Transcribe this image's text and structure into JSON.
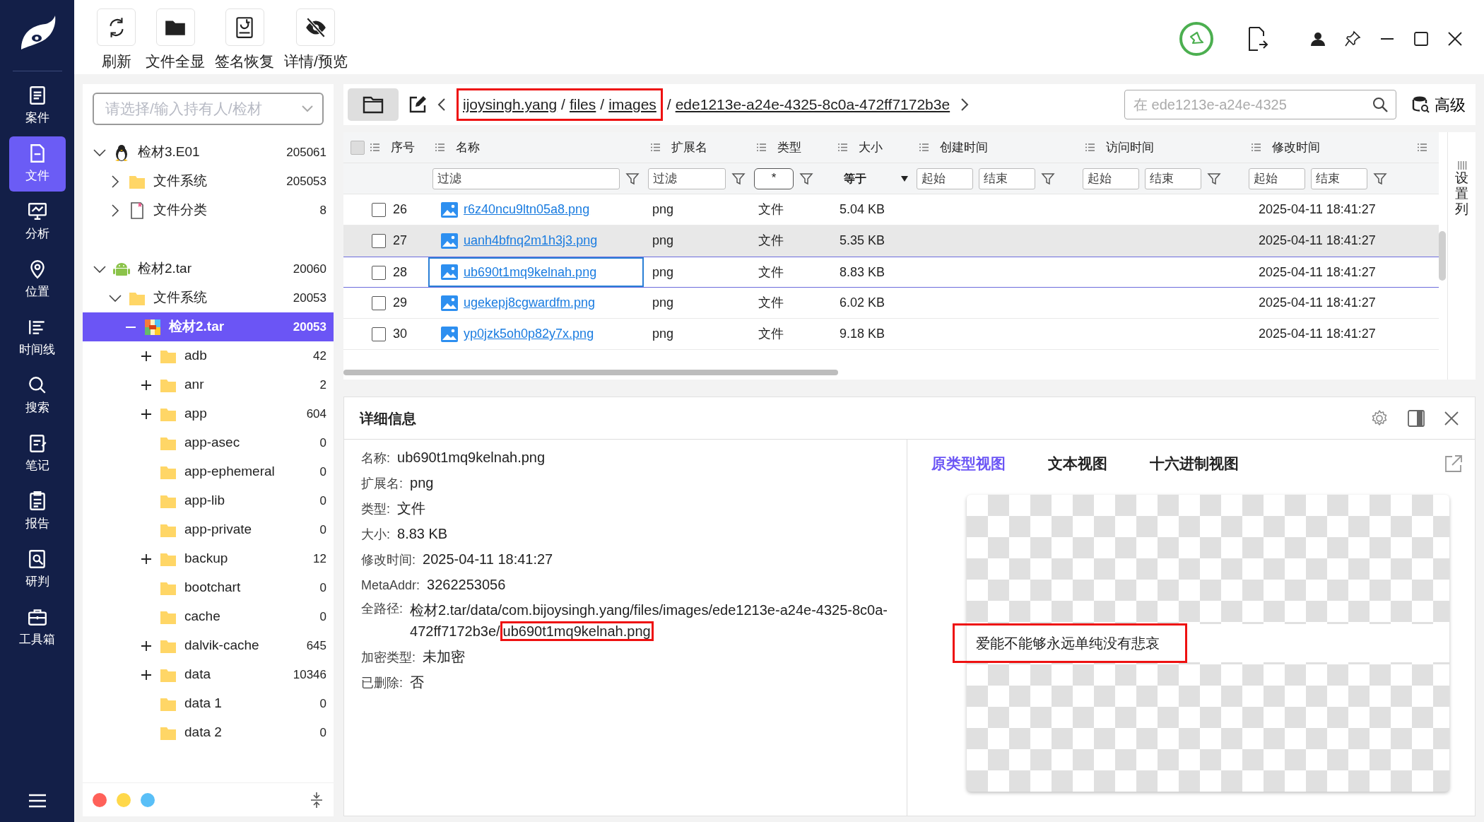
{
  "nav": {
    "items": [
      {
        "label": "案件",
        "selected": false
      },
      {
        "label": "文件",
        "selected": true
      },
      {
        "label": "分析",
        "selected": false
      },
      {
        "label": "位置",
        "selected": false
      },
      {
        "label": "时间线",
        "selected": false
      },
      {
        "label": "搜索",
        "selected": false
      },
      {
        "label": "笔记",
        "selected": false
      },
      {
        "label": "报告",
        "selected": false
      },
      {
        "label": "研判",
        "selected": false
      },
      {
        "label": "工具箱",
        "selected": false
      }
    ]
  },
  "toolbar": [
    "刷新",
    "文件全显",
    "签名恢复",
    "详情/预览"
  ],
  "tree": {
    "selector": {
      "placeholder": "请选择/输入持有人/检材"
    },
    "sources": [
      {
        "label": "检材3.E01",
        "count": "205061",
        "kind": "linux",
        "expanded": true,
        "selected": false,
        "children": [
          {
            "label": "文件系统",
            "count": "205053",
            "kind": "folder",
            "expanded": false,
            "selected": false
          },
          {
            "label": "文件分类",
            "count": "8",
            "kind": "doc",
            "expanded": false,
            "selected": false
          }
        ]
      },
      {
        "label": "检材2.tar",
        "count": "20060",
        "kind": "android",
        "expanded": true,
        "selected": false,
        "children": [
          {
            "label": "文件系统",
            "count": "20053",
            "kind": "folder",
            "expanded": true,
            "selected": false,
            "children": [
              {
                "label": "检材2.tar",
                "count": "20053",
                "kind": "archive",
                "expanded": true,
                "selected": true,
                "children": [
                  {
                    "label": "adb",
                    "count": "42",
                    "kind": "folder",
                    "expanded": false,
                    "selected": false
                  },
                  {
                    "label": "anr",
                    "count": "2",
                    "kind": "folder",
                    "expanded": false,
                    "selected": false
                  },
                  {
                    "label": "app",
                    "count": "604",
                    "kind": "folder",
                    "expanded": false,
                    "selected": false
                  },
                  {
                    "label": "app-asec",
                    "count": "0",
                    "kind": "folder",
                    "selected": false
                  },
                  {
                    "label": "app-ephemeral",
                    "count": "0",
                    "kind": "folder",
                    "selected": false
                  },
                  {
                    "label": "app-lib",
                    "count": "0",
                    "kind": "folder",
                    "selected": false
                  },
                  {
                    "label": "app-private",
                    "count": "0",
                    "kind": "folder",
                    "selected": false
                  },
                  {
                    "label": "backup",
                    "count": "12",
                    "kind": "folder",
                    "expanded": false,
                    "selected": false
                  },
                  {
                    "label": "bootchart",
                    "count": "0",
                    "kind": "folder",
                    "selected": false
                  },
                  {
                    "label": "cache",
                    "count": "0",
                    "kind": "folder",
                    "selected": false
                  },
                  {
                    "label": "dalvik-cache",
                    "count": "645",
                    "kind": "folder",
                    "expanded": false,
                    "selected": false
                  },
                  {
                    "label": "data",
                    "count": "10346",
                    "kind": "folder",
                    "expanded": false,
                    "selected": false
                  },
                  {
                    "label": "data 1",
                    "count": "0",
                    "kind": "folder",
                    "selected": false
                  },
                  {
                    "label": "data 2",
                    "count": "0",
                    "kind": "folder",
                    "selected": false
                  }
                ]
              }
            ]
          }
        ]
      }
    ],
    "tags": [
      {
        "color": "#ff6159"
      },
      {
        "color": "#ffd84a"
      },
      {
        "color": "#59bff7"
      }
    ]
  },
  "breadcrumb": [
    {
      "kind": "crumb",
      "text": "ijoysingh.yang",
      "highlighted": true
    },
    {
      "kind": "sep",
      "text": "/",
      "highlighted": true
    },
    {
      "kind": "crumb",
      "text": "files",
      "highlighted": true
    },
    {
      "kind": "sep",
      "text": "/",
      "highlighted": true
    },
    {
      "kind": "crumb",
      "text": "images",
      "highlighted": true
    },
    {
      "kind": "sep",
      "text": "/",
      "highlighted": false
    },
    {
      "kind": "crumb",
      "text": "ede1213e-a24e-4325-8c0a-472ff7172b3e",
      "highlighted": false
    }
  ],
  "search": {
    "placeholder": "在 ede1213e-a24e-4325"
  },
  "advanced_button": "高级",
  "table": {
    "columns": [
      "序号",
      "名称",
      "扩展名",
      "类型",
      "大小",
      "创建时间",
      "访问时间",
      "修改时间"
    ],
    "select_all": {
      "checked": false
    },
    "filters": {
      "name": {
        "placeholder": "过滤"
      },
      "ext": {
        "placeholder": "过滤"
      },
      "type": "*",
      "size": "等于",
      "created_from": {
        "placeholder": "起始"
      },
      "created_to": {
        "placeholder": "结束"
      },
      "accessed_from": {
        "placeholder": "起始"
      },
      "accessed_to": {
        "placeholder": "结束"
      },
      "modified_from": {
        "placeholder": "起始"
      },
      "modified_to": {
        "placeholder": "结束"
      }
    },
    "column_settings": "设置列",
    "rows": [
      {
        "no": "26",
        "name": "r6z40ncu9ltn05a8.png",
        "ext": "png",
        "type": "文件",
        "size": "5.04 KB",
        "modified": "2025-04-11 18:41:27",
        "checked": false,
        "hovered": false,
        "selected": false
      },
      {
        "no": "27",
        "name": "uanh4bfnq2m1h3j3.png",
        "ext": "png",
        "type": "文件",
        "size": "5.35 KB",
        "modified": "2025-04-11 18:41:27",
        "checked": false,
        "hovered": true,
        "selected": false
      },
      {
        "no": "28",
        "name": "ub690t1mq9kelnah.png",
        "ext": "png",
        "type": "文件",
        "size": "8.83 KB",
        "modified": "2025-04-11 18:41:27",
        "checked": false,
        "hovered": false,
        "selected": true
      },
      {
        "no": "29",
        "name": "ugekepj8cgwardfm.png",
        "ext": "png",
        "type": "文件",
        "size": "6.02 KB",
        "modified": "2025-04-11 18:41:27",
        "checked": false,
        "hovered": false,
        "selected": false
      },
      {
        "no": "30",
        "name": "yp0jzk5oh0p82y7x.png",
        "ext": "png",
        "type": "文件",
        "size": "9.18 KB",
        "modified": "2025-04-11 18:41:27",
        "checked": false,
        "hovered": false,
        "selected": false
      }
    ]
  },
  "details": {
    "title": "详细信息",
    "fields": [
      {
        "label": "名称:",
        "value": "ub690t1mq9kelnah.png"
      },
      {
        "label": "扩展名:",
        "value": "png"
      },
      {
        "label": "类型:",
        "value": "文件"
      },
      {
        "label": "大小:",
        "value": "8.83 KB"
      },
      {
        "label": "修改时间:",
        "value": "2025-04-11 18:41:27"
      },
      {
        "label": "MetaAddr:",
        "value": "3262253056"
      },
      {
        "label": "全路径:",
        "parts": [
          {
            "text": "检材2.tar/data/com.bijoysingh.yang/files/images/ede1213e-a24e-4325-8c0a-472ff7172b3e/",
            "highlighted": false
          },
          {
            "text": "ub690t1mq9kelnah.png",
            "highlighted": true
          }
        ]
      },
      {
        "label": "加密类型:",
        "value": "未加密"
      },
      {
        "label": "已删除:",
        "value": "否"
      }
    ],
    "tabs": [
      {
        "label": "原类型视图",
        "selected": true
      },
      {
        "label": "文本视图",
        "selected": false
      },
      {
        "label": "十六进制视图",
        "selected": false
      }
    ],
    "preview": {
      "text": "爱能不能够永远单纯没有悲哀",
      "highlighted": true
    }
  }
}
